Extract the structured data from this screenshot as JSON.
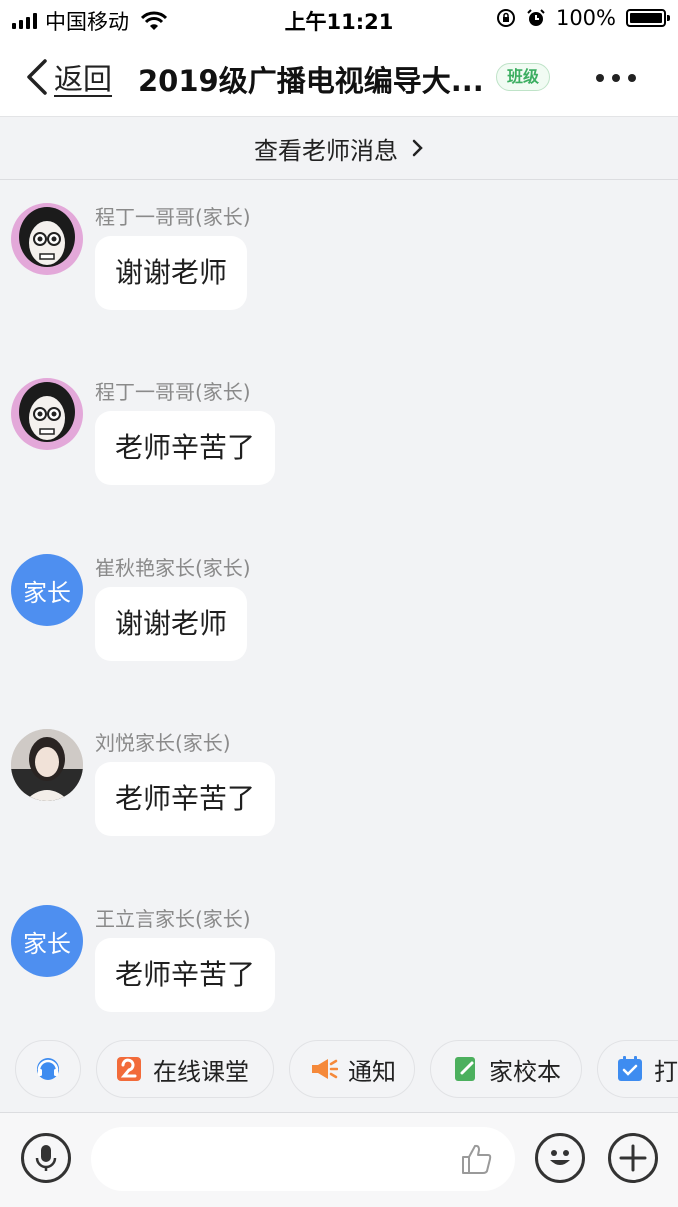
{
  "status_bar": {
    "carrier": "中国移动",
    "time": "上午11:21",
    "battery": "100%",
    "battery_level": 1.0
  },
  "nav": {
    "back_label": "返回",
    "title": "2019级广播电视编导大...",
    "badge": "班级"
  },
  "teacher_messages": {
    "label": "查看老师消息"
  },
  "messages": [
    {
      "sender": "程丁一哥哥(家长)",
      "text": "谢谢老师",
      "avatar_type": "drawn"
    },
    {
      "sender": "程丁一哥哥(家长)",
      "text": "老师辛苦了",
      "avatar_type": "drawn"
    },
    {
      "sender": "崔秋艳家长(家长)",
      "text": "谢谢老师",
      "avatar_type": "text",
      "avatar_text": "家长"
    },
    {
      "sender": "刘悦家长(家长)",
      "text": "老师辛苦了",
      "avatar_type": "photo"
    },
    {
      "sender": "王立言家长(家长)",
      "text": "老师辛苦了",
      "avatar_type": "text",
      "avatar_text": "家长"
    }
  ],
  "quick_actions": [
    {
      "label": "在线课堂",
      "icon": "online-class-icon",
      "color": "#f26b3a"
    },
    {
      "label": "通知",
      "icon": "megaphone-icon",
      "color": "#f5893a"
    },
    {
      "label": "家校本",
      "icon": "notebook-icon",
      "color": "#4cb05e"
    },
    {
      "label": "打",
      "icon": "checkin-calendar-icon",
      "color": "#3e8cf0"
    }
  ],
  "colors": {
    "accent_blue": "#4e8ff0",
    "badge_green": "#3cae61",
    "background": "#f2f3f5"
  }
}
